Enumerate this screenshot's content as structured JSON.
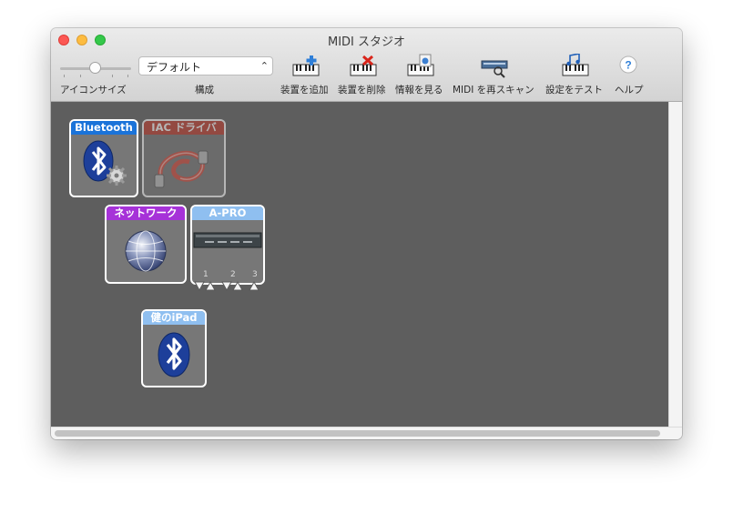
{
  "window": {
    "title": "MIDI スタジオ"
  },
  "toolbar": {
    "icon_size_label": "アイコンサイズ",
    "config_label": "構成",
    "config_value": "デフォルト",
    "add_device": "装置を追加",
    "remove_device": "装置を削除",
    "show_info": "情報を見る",
    "rescan": "MIDI を再スキャン",
    "test_setup": "設定をテスト",
    "help": "ヘルプ",
    "help_glyph": "?"
  },
  "devices": {
    "bluetooth": {
      "name": "Bluetooth",
      "color": "#1a73d9"
    },
    "iac": {
      "name": "IAC ドライバ",
      "color": "#c0392b"
    },
    "network": {
      "name": "ネットワーク",
      "color": "#a632d8"
    },
    "apro": {
      "name": "A-PRO",
      "color": "#8fbff0",
      "ports": [
        "1",
        "2",
        "3"
      ]
    },
    "ipad": {
      "name": "健のiPad",
      "color": "#8fbff0"
    }
  }
}
